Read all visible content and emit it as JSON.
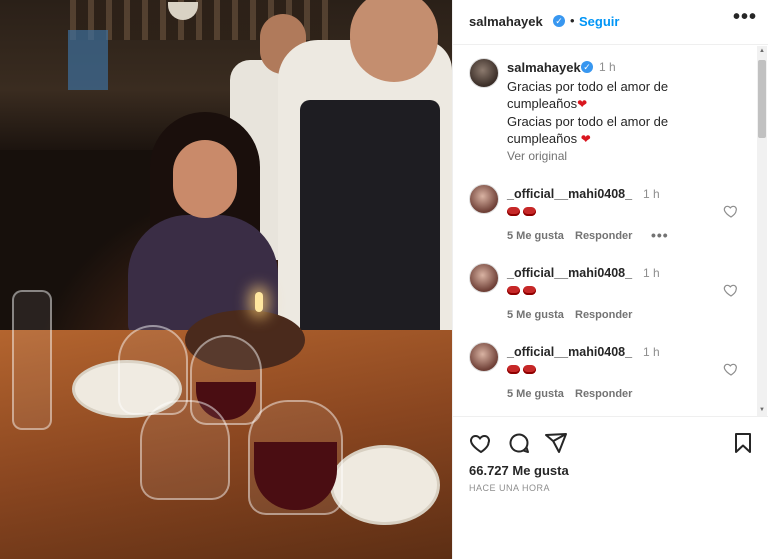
{
  "header": {
    "username": "salmahayek",
    "separator": "•",
    "follow_label": "Seguir",
    "more_label": "•••"
  },
  "caption": {
    "username": "salmahayek",
    "time": "1 h",
    "line1": "Gracias por todo el amor de",
    "line2": "cumpleaños",
    "line3": "Gracias por todo el amor de",
    "line4": "cumpleaños",
    "see_original": "Ver original"
  },
  "comments": [
    {
      "username": "_official__mahi0408_",
      "time": "1 h",
      "likes": "5 Me gusta",
      "reply": "Responder",
      "more": "•••"
    },
    {
      "username": "_official__mahi0408_",
      "time": "1 h",
      "likes": "5 Me gusta",
      "reply": "Responder"
    },
    {
      "username": "_official__mahi0408_",
      "time": "1 h",
      "likes": "5 Me gusta",
      "reply": "Responder"
    }
  ],
  "footer": {
    "likes": "66.727 Me gusta",
    "ago": "HACE UNA HORA"
  },
  "colors": {
    "accent": "#0095f6",
    "verified": "#3897f0",
    "heart": "#d9161f"
  },
  "icons": [
    "verified-badge-icon",
    "heart-icon",
    "comment-icon",
    "share-icon",
    "bookmark-icon",
    "lips-emoji-icon"
  ]
}
